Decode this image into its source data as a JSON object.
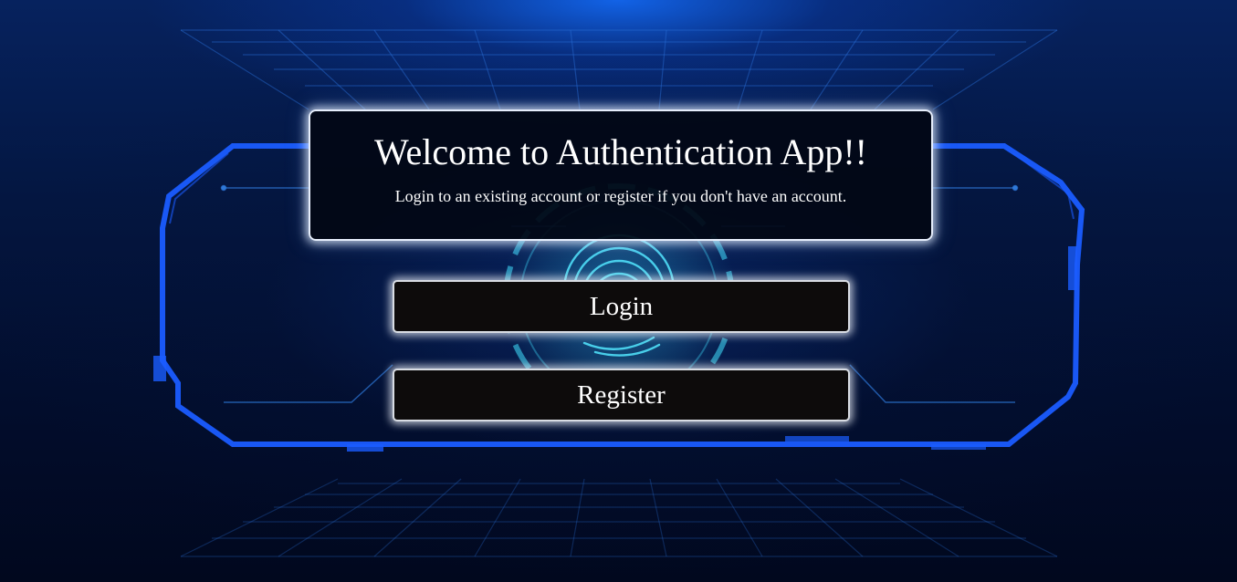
{
  "welcome": {
    "title": "Welcome to Authentication App!!",
    "subtitle": "Login to an existing account or register if you don't have an account."
  },
  "actions": {
    "login_label": "Login",
    "register_label": "Register"
  },
  "background": {
    "icon": "fingerprint-icon",
    "frame_color": "#1a5cff",
    "grid_color": "#2b6fd6",
    "fingerprint_color": "#3fe0ff"
  }
}
